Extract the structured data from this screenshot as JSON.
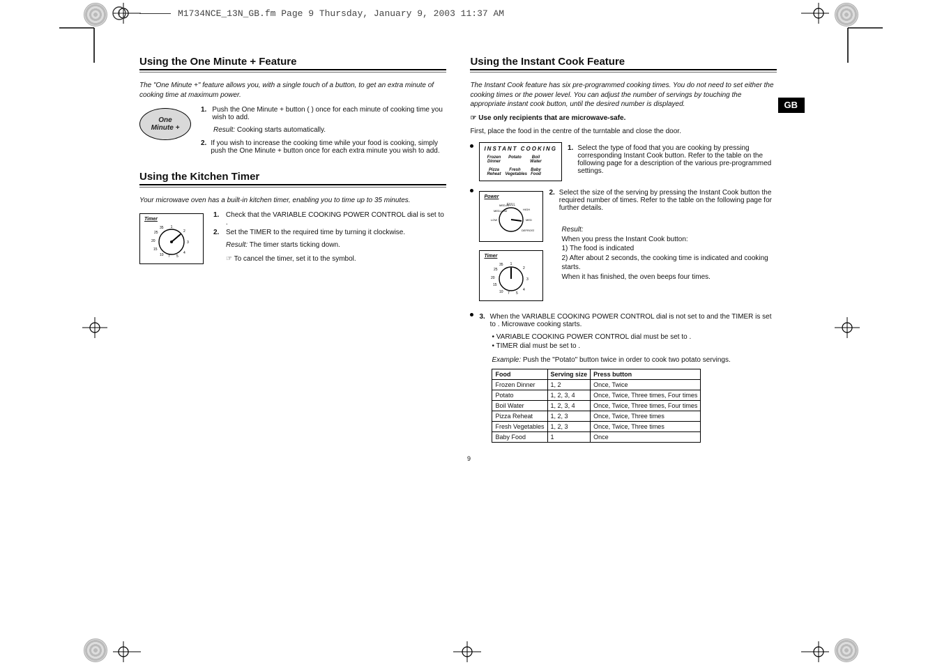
{
  "header": {
    "filename_line": "M1734NCE_13N_GB.fm  Page 9  Thursday, January 9, 2003  11:37 AM"
  },
  "tab": {
    "label": "GB"
  },
  "page_number": "9",
  "left": {
    "section1": {
      "title": "Using the One Minute + Feature",
      "intro": "The \"One Minute +\" feature allows you, with a single touch of a button, to get an extra minute of cooking time at maximum power.",
      "oval_label": "One\nMinute +",
      "step1_n": "1.",
      "step1_text": "Push the One Minute + button ( ) once for each minute of cooking time you wish to add.",
      "result_label": "Result:",
      "result_text": " Cooking starts automatically.",
      "step2_n": "2.",
      "step2_text": "If you wish to increase the cooking time while your food is cooking, simply push the One Minute + button once for each extra minute you wish to add."
    },
    "section2": {
      "title": "Using the Kitchen Timer",
      "intro": "Your microwave oven has a built-in kitchen timer, enabling you to time up to 35 minutes.",
      "dial_label": "Timer",
      "step1_n": "1.",
      "step1_text": "Check that the VARIABLE COOKING POWER CONTROL dial is set to  .",
      "step2_n": "2.",
      "step2_text": "Set the TIMER to the required time by turning it clockwise.",
      "result_label": "Result:",
      "result_text": " The timer starts ticking down.",
      "note": "☞ To cancel the timer, set it to the   symbol."
    }
  },
  "right": {
    "section": {
      "title": "Using the Instant Cook Feature",
      "intro": "The Instant Cook feature has six pre-programmed cooking times. You do not need to set either the cooking times or the power level. You can adjust the number of servings by touching the appropriate instant cook button, until the desired number is displayed.",
      "note_bold": "☞ Use only recipients that are microwave-safe.",
      "open_line": "First, place the food in the centre of the turntable and close the door.",
      "panel": {
        "title": "INSTANT COOKING",
        "cells": [
          "Frozen Dinner",
          "Potato",
          "Boil Water",
          "Pizza Reheat",
          "Fresh Vegetables",
          "Baby Food"
        ]
      },
      "bullet1": {
        "n": "1.",
        "text": "Select the type of food that you are cooking by pressing corresponding Instant Cook button. Refer to the table on the following page for a description of the various pre-programmed settings."
      },
      "bullet2": {
        "n": "2.",
        "text": "Select the size of the serving by pressing the Instant Cook button the required number of times. Refer to the table on the following page for further details.",
        "result_label": "Result:",
        "result_text": " When you press the Instant Cook button:\n1) The food is indicated\n2) After about 2 seconds, the cooking time is indicated and cooking starts.\nWhen it has finished, the oven beeps four times."
      },
      "dial_power_label": "Power",
      "dial_timer_label": "Timer",
      "bullet3": {
        "n": "3.",
        "text": "When the VARIABLE COOKING POWER CONTROL dial is not set to  and the TIMER is set to  . Microwave cooking starts.",
        "sub": "• VARIABLE COOKING POWER CONTROL dial must be set to  .\n• TIMER dial must be set to  .",
        "example_title": "Example:",
        "example_text": " Push the \"Potato\" button twice in order to cook two potato servings.",
        "table": {
          "headers": [
            "Food",
            "Serving size",
            "Press button"
          ],
          "rows": [
            [
              "Frozen Dinner",
              "1, 2",
              "Once, Twice"
            ],
            [
              "Potato",
              "1, 2, 3, 4",
              "Once, Twice, Three times, Four times"
            ],
            [
              "Boil Water",
              "1, 2, 3, 4",
              "Once, Twice, Three times, Four times"
            ],
            [
              "Pizza Reheat",
              "1, 2, 3",
              "Once, Twice, Three times"
            ],
            [
              "Fresh Vegetables",
              "1, 2, 3",
              "Once, Twice, Three times"
            ],
            [
              "Baby Food",
              "1",
              "Once"
            ]
          ]
        }
      }
    }
  }
}
